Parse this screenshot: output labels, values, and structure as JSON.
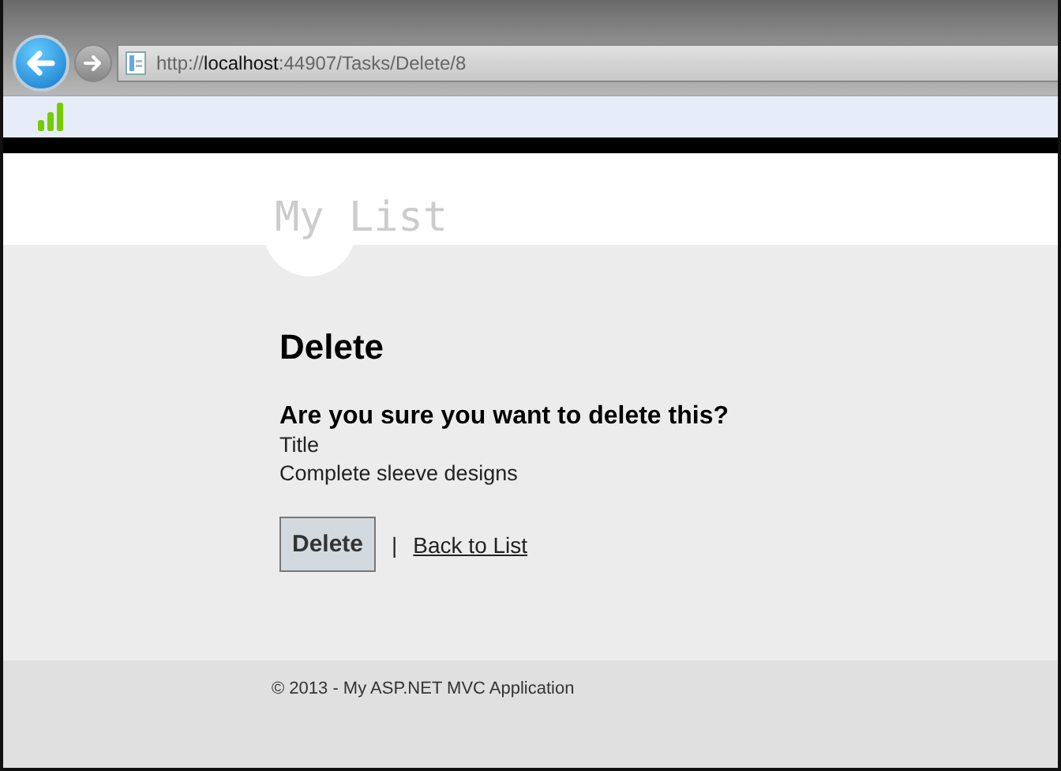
{
  "browser": {
    "address": {
      "scheme": "http://",
      "host": "localhost",
      "rest": ":44907/Tasks/Delete/8"
    }
  },
  "site": {
    "title": "My List"
  },
  "page": {
    "heading": "Delete",
    "question": "Are you sure you want to delete this?",
    "field_label": "Title",
    "field_value": "Complete sleeve designs",
    "delete_button": "Delete",
    "separator": "|",
    "back_link": "Back to List"
  },
  "footer": {
    "text": "© 2013 - My ASP.NET MVC Application"
  }
}
